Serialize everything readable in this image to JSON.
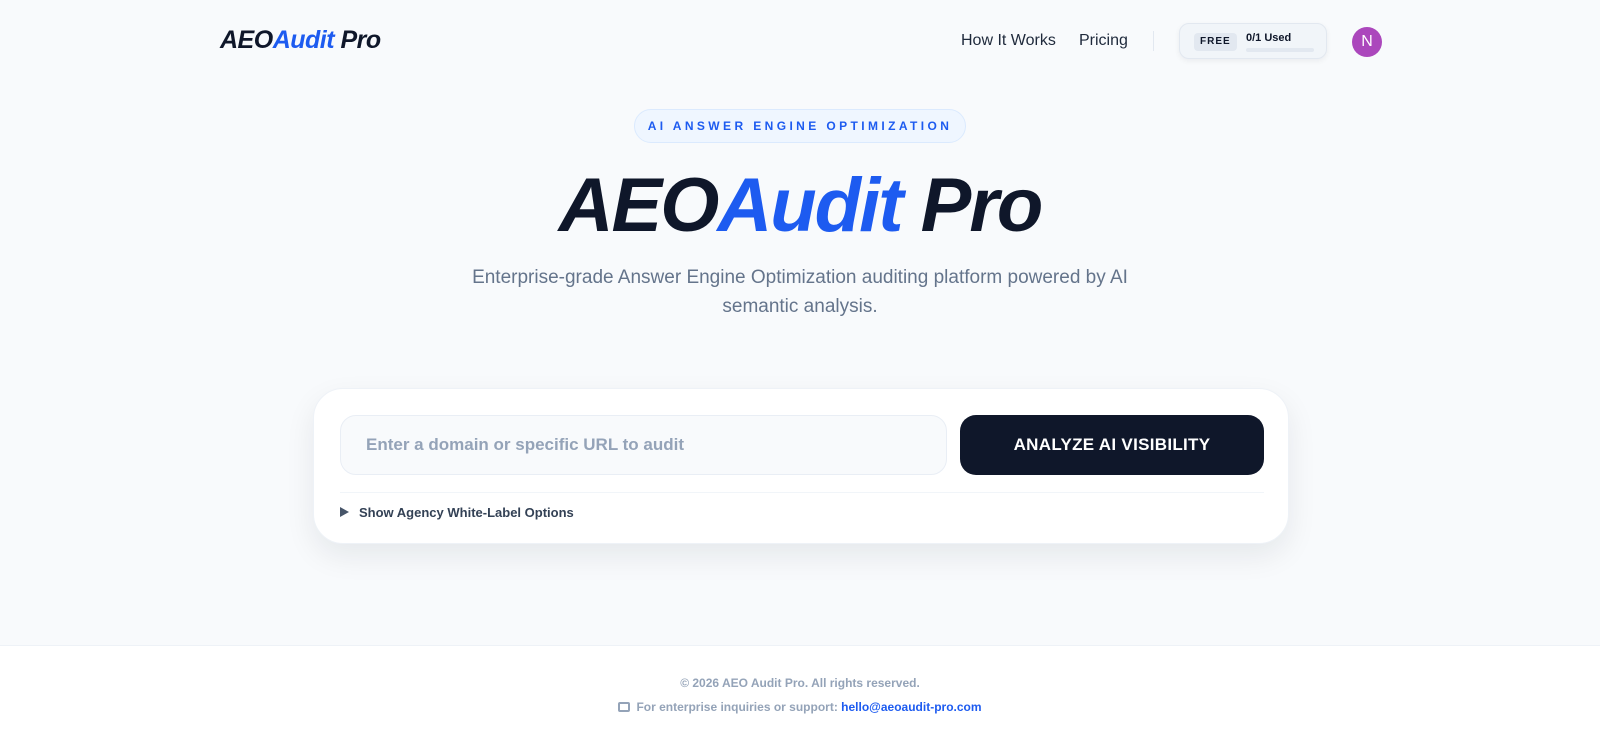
{
  "header": {
    "logo_primary": "AEO",
    "logo_accent": "Audit",
    "logo_suffix": " Pro",
    "nav": [
      {
        "label": "How It Works"
      },
      {
        "label": "Pricing"
      }
    ],
    "usage": {
      "plan_badge": "FREE",
      "used_label": "0/1 Used",
      "used_fraction": 0
    },
    "avatar_initial": "N"
  },
  "hero": {
    "eyebrow": "AI ANSWER ENGINE OPTIMIZATION",
    "title_primary": "AEO",
    "title_accent": "Audit",
    "title_suffix": " Pro",
    "subtitle": "Enterprise-grade Answer Engine Optimization auditing platform powered by AI semantic analysis."
  },
  "audit": {
    "input_placeholder": "Enter a domain or specific URL to audit",
    "input_value": "",
    "button_label": "ANALYZE AI VISIBILITY",
    "whitelabel_label": "Show Agency White-Label Options",
    "whitelabel_icon": "triangle-right-icon"
  },
  "footer": {
    "copyright": "© 2026 AEO Audit Pro. All rights reserved.",
    "support_icon": "mail-icon",
    "support_text": "For enterprise inquiries or support:",
    "support_email": "hello@aeoaudit-pro.com"
  },
  "colors": {
    "accent": "#1d5bf0",
    "dark": "#0f172a",
    "muted": "#64748b",
    "avatar": "#ab47bc",
    "background": "#f8fafc"
  }
}
